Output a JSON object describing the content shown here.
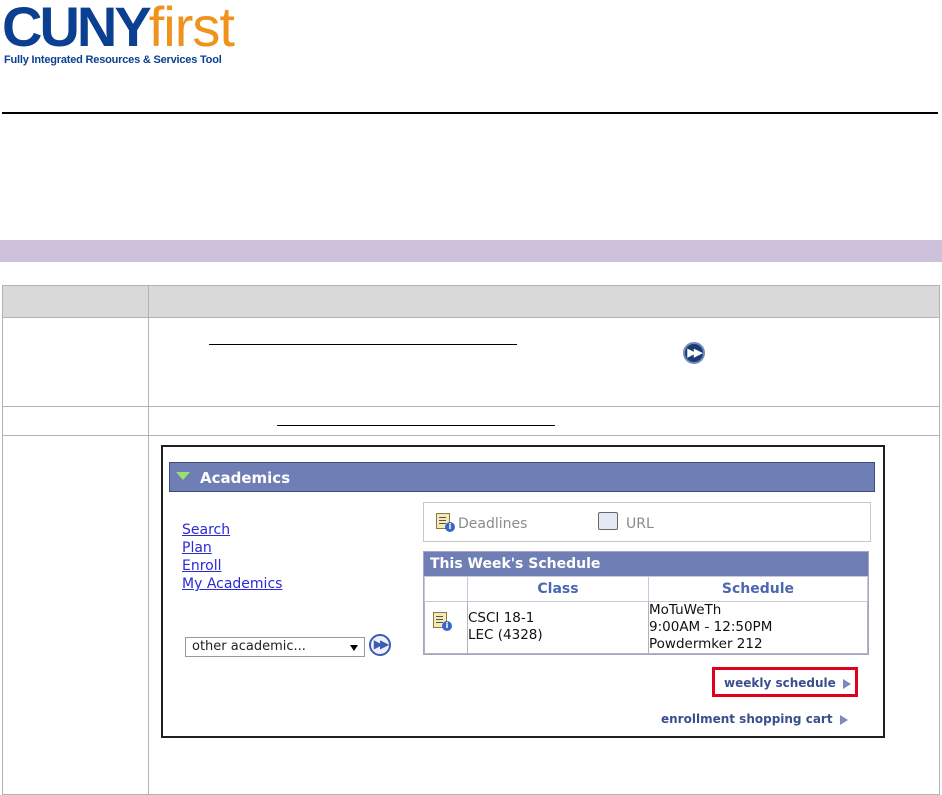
{
  "logo": {
    "brand_main": "CUNY",
    "brand_accent": "first",
    "tagline": "Fully Integrated Resources & Services Tool"
  },
  "colors": {
    "brand_blue": "#0b3f91",
    "brand_orange": "#f0931c",
    "band": "#ccc0da",
    "header_bar": "#6f7fb5",
    "highlight_box": "#e0001a"
  },
  "embedded_screenshot": {
    "section_title": "Academics",
    "links": [
      "Search",
      "Plan",
      "Enroll",
      "My Academics"
    ],
    "dropdown_value": "other academic...",
    "go_icon": "double-chevron-right-icon",
    "deadlines_label": "Deadlines",
    "url_label": "URL",
    "schedule": {
      "title": "This Week's Schedule",
      "columns": [
        "Class",
        "Schedule"
      ],
      "rows": [
        {
          "class_line1": "CSCI 18-1",
          "class_line2": "LEC (4328)",
          "sched_line1": "MoTuWeTh",
          "sched_line2": "9:00AM - 12:50PM",
          "sched_line3": "Powdermker 212"
        }
      ]
    },
    "weekly_schedule_link": "weekly schedule",
    "cart_link": "enrollment shopping cart"
  }
}
